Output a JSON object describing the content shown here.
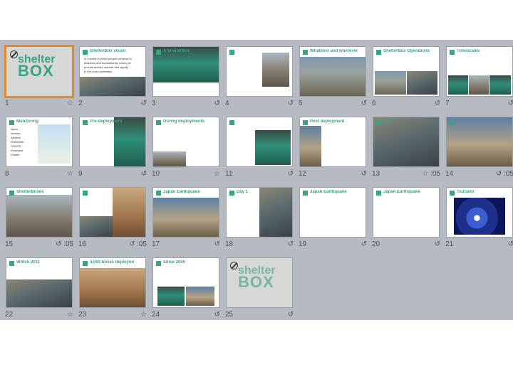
{
  "slides": [
    {
      "number": "1",
      "timing": "",
      "icon": "animation-icon",
      "brand_line1": "shelter",
      "brand_line2": "BOX",
      "selected": true
    },
    {
      "number": "2",
      "timing": "",
      "icon": "transition-icon",
      "title": "ShelterBox vision",
      "lines": [
        "In a world in which people continue to",
        "disasters and humanitarian crises we",
        "provide shelter, warmth and dignity",
        "to the most vulnerable"
      ]
    },
    {
      "number": "3",
      "timing": "",
      "icon": "transition-icon",
      "title": "A ShelterBox"
    },
    {
      "number": "4",
      "timing": "",
      "icon": "transition-icon"
    },
    {
      "number": "5",
      "timing": "",
      "icon": "transition-icon",
      "title": "Whatever and wherever"
    },
    {
      "number": "6",
      "timing": "",
      "icon": "transition-icon",
      "title": "ShelterBox Operations"
    },
    {
      "number": "7",
      "timing": "",
      "icon": "transition-icon",
      "title": "Timescales"
    },
    {
      "number": "8",
      "timing": "",
      "icon": "animation-icon",
      "title": "Monitoring",
      "lines": [
        "News",
        "Internet",
        "Alertnet",
        "ReliefWeb",
        "GDACS",
        "Rotarians",
        "Emails"
      ]
    },
    {
      "number": "9",
      "timing": "",
      "icon": "transition-icon",
      "title": "Pre-deployment"
    },
    {
      "number": "10",
      "timing": "",
      "icon": "animation-icon",
      "title": "During deployments"
    },
    {
      "number": "11",
      "timing": "",
      "icon": "transition-icon"
    },
    {
      "number": "12",
      "timing": "",
      "icon": "transition-icon",
      "title": "Post deployment"
    },
    {
      "number": "13",
      "timing": ":05",
      "icon": "animation-icon",
      "title": "Haiti"
    },
    {
      "number": "14",
      "timing": ":05",
      "icon": "transition-icon"
    },
    {
      "number": "15",
      "timing": ":05",
      "icon": "transition-icon",
      "title": "ShelterBoxes"
    },
    {
      "number": "16",
      "timing": ":05",
      "icon": "transition-icon"
    },
    {
      "number": "17",
      "timing": "",
      "icon": "transition-icon",
      "title": "Japan Earthquake"
    },
    {
      "number": "18",
      "timing": "",
      "icon": "transition-icon",
      "title": "Day 1"
    },
    {
      "number": "19",
      "timing": "",
      "icon": "transition-icon",
      "title": "Japan Earthquake"
    },
    {
      "number": "20",
      "timing": "",
      "icon": "transition-icon",
      "title": "Japan Earthquake"
    },
    {
      "number": "21",
      "timing": "",
      "icon": "transition-icon",
      "title": "Tsunami"
    },
    {
      "number": "22",
      "timing": "",
      "icon": "animation-icon",
      "title": "Within 2011"
    },
    {
      "number": "23",
      "timing": "",
      "icon": "animation-icon",
      "title": "4,000 boxes deployed"
    },
    {
      "number": "24",
      "timing": "",
      "icon": "transition-icon",
      "title": "Since 2000"
    },
    {
      "number": "25",
      "timing": "",
      "icon": "transition-icon",
      "brand_line1": "shelter",
      "brand_line2": "BOX"
    }
  ],
  "colors": {
    "accent": "#3aa385",
    "selection": "#e58a2c",
    "sorter_bg": "#b6bbc3"
  }
}
